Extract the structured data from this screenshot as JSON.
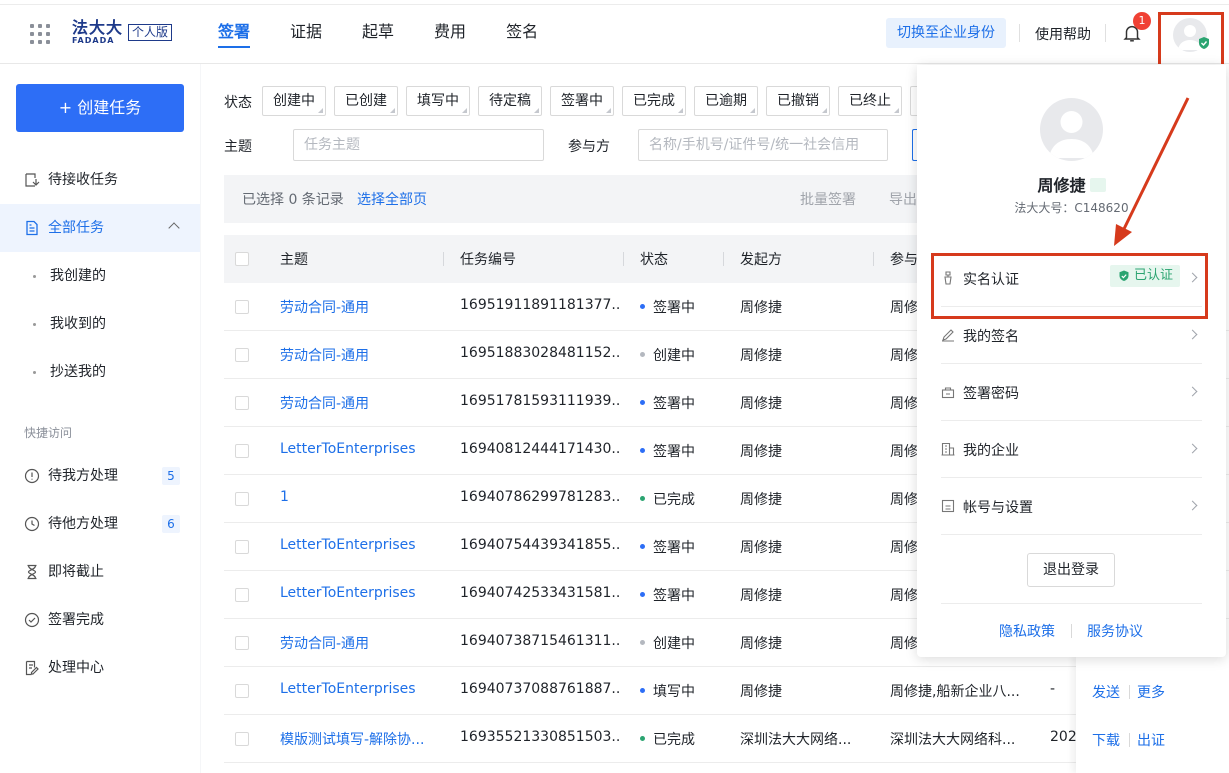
{
  "header": {
    "logo_text": "法大大",
    "logo_sub": "FADADA",
    "edition_badge": "个人版",
    "tabs": [
      {
        "label": "签署",
        "active": true
      },
      {
        "label": "证据",
        "active": false
      },
      {
        "label": "起草",
        "active": false
      },
      {
        "label": "费用",
        "active": false
      },
      {
        "label": "签名",
        "active": false
      }
    ],
    "switch_identity": "切换至企业身份",
    "help": "使用帮助",
    "notification_count": "1",
    "icons": [
      "apps-grid-icon",
      "bell-icon",
      "avatar-icon",
      "verified-shield-icon"
    ]
  },
  "sidebar": {
    "create_button": "+ 创建任务",
    "items": [
      {
        "label": "待接收任务",
        "icon": "inbox-icon"
      },
      {
        "label": "全部任务",
        "icon": "document-icon",
        "active": true
      }
    ],
    "sub_items": [
      {
        "label": "我创建的"
      },
      {
        "label": "我收到的"
      },
      {
        "label": "抄送我的"
      }
    ],
    "quick_caption": "快捷访问",
    "quick_items": [
      {
        "label": "待我方处理",
        "icon": "alert-circle-icon",
        "count": "5"
      },
      {
        "label": "待他方处理",
        "icon": "clock-icon",
        "count": "6"
      },
      {
        "label": "即将截止",
        "icon": "hourglass-icon"
      },
      {
        "label": "签署完成",
        "icon": "check-circle-icon"
      },
      {
        "label": "处理中心",
        "icon": "edit-doc-icon"
      }
    ]
  },
  "filters": {
    "status_label": "状态",
    "statuses": [
      "创建中",
      "已创建",
      "填写中",
      "待定稿",
      "签署中",
      "已完成",
      "已逾期",
      "已撤销",
      "已终止"
    ],
    "subject_label": "主题",
    "subject_placeholder": "任务主题",
    "party_label": "参与方",
    "party_placeholder": "名称/手机号/证件号/统一社会信用"
  },
  "selection": {
    "selected_text": "已选择 0 条记录",
    "select_all_pages": "选择全部页",
    "batch_sign": "批量签署",
    "export": "导出"
  },
  "table": {
    "columns": [
      "主题",
      "任务编号",
      "状态",
      "发起方",
      "参与"
    ],
    "rows": [
      {
        "subject": "劳动合同-通用",
        "id": "16951911891181377...",
        "status": "签署中",
        "status_color": "#2d6ef6",
        "initiator": "周修捷",
        "party": "周修"
      },
      {
        "subject": "劳动合同-通用",
        "id": "16951883028481152...",
        "status": "创建中",
        "status_color": "#b4b8bf",
        "initiator": "周修捷",
        "party": "周修"
      },
      {
        "subject": "劳动合同-通用",
        "id": "16951781593111939...",
        "status": "签署中",
        "status_color": "#2d6ef6",
        "initiator": "周修捷",
        "party": "周修"
      },
      {
        "subject": "LetterToEnterprises",
        "id": "16940812444171430...",
        "status": "签署中",
        "status_color": "#2d6ef6",
        "initiator": "周修捷",
        "party": "周修"
      },
      {
        "subject": "1",
        "id": "16940786299781283...",
        "status": "已完成",
        "status_color": "#2ba471",
        "initiator": "周修捷",
        "party": "周修"
      },
      {
        "subject": "LetterToEnterprises",
        "id": "16940754439341855...",
        "status": "签署中",
        "status_color": "#2d6ef6",
        "initiator": "周修捷",
        "party": "周修"
      },
      {
        "subject": "LetterToEnterprises",
        "id": "16940742533431581...",
        "status": "签署中",
        "status_color": "#2d6ef6",
        "initiator": "周修捷",
        "party": "周修"
      },
      {
        "subject": "劳动合同-通用",
        "id": "16940738715461311...",
        "status": "创建中",
        "status_color": "#b4b8bf",
        "initiator": "周修捷",
        "party": "周修"
      },
      {
        "subject": "LetterToEnterprises",
        "id": "16940737088761887...",
        "status": "填写中",
        "status_color": "#2d6ef6",
        "initiator": "周修捷",
        "party": "周修捷,船新企业八...",
        "extra": "-",
        "ops": [
          "发送",
          "更多"
        ]
      },
      {
        "subject": "模版测试填写-解除协...",
        "id": "16935521330851503...",
        "status": "已完成",
        "status_color": "#2ba471",
        "initiator": "深圳法大大网络...",
        "party": "深圳法大大网络科...",
        "extra": "202",
        "ops": [
          "下载",
          "出证"
        ]
      }
    ]
  },
  "profile_menu": {
    "name": "周修捷",
    "account_id": "法大大号：C148620",
    "items": [
      {
        "label": "实名认证",
        "icon": "id-icon",
        "badge": "已认证"
      },
      {
        "label": "我的签名",
        "icon": "pen-icon"
      },
      {
        "label": "签署密码",
        "icon": "lock-box-icon"
      },
      {
        "label": "我的企业",
        "icon": "building-icon"
      },
      {
        "label": "帐号与设置",
        "icon": "settings-doc-icon"
      }
    ],
    "logout": "退出登录",
    "privacy": "隐私政策",
    "service": "服务协议"
  },
  "colors": {
    "primary": "#1d6fe8",
    "annotation_red": "#d63a1c",
    "verified_green": "#2ba471"
  }
}
